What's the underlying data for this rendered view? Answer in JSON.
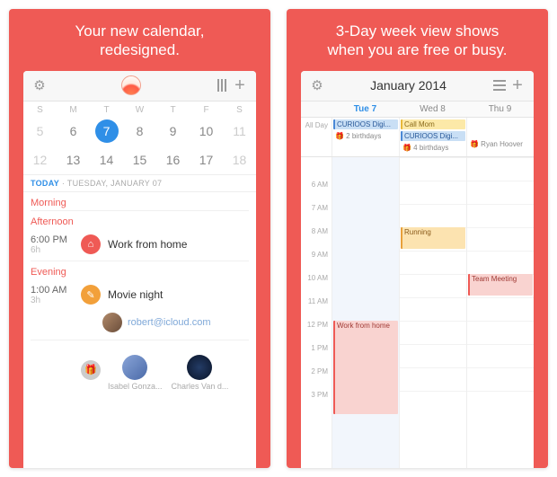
{
  "left": {
    "slogan_line1": "Your new calendar,",
    "slogan_line2": "redesigned.",
    "dow": [
      "S",
      "M",
      "T",
      "W",
      "T",
      "F",
      "S"
    ],
    "row1": [
      "5",
      "6",
      "7",
      "8",
      "9",
      "10",
      "11"
    ],
    "row2": [
      "12",
      "13",
      "14",
      "15",
      "16",
      "17",
      "18"
    ],
    "today_label": "TODAY",
    "today_sep": " · ",
    "today_date": "TUESDAY, JANUARY 07",
    "sections": {
      "morning": "Morning",
      "afternoon": "Afternoon",
      "evening": "Evening"
    },
    "events": {
      "work": {
        "time": "6:00 PM",
        "duration": "6h",
        "title": "Work from home"
      },
      "movie": {
        "time": "1:00 AM",
        "duration": "3h",
        "title": "Movie night"
      }
    },
    "attendee_email": "robert@icloud.com",
    "birthdays": {
      "gift_label": "",
      "p1": "Isabel Gonza...",
      "p2": "Charles Van d..."
    }
  },
  "right": {
    "slogan_line1": "3-Day week view shows",
    "slogan_line2": "when you are free or busy.",
    "title": "January 2014",
    "days": {
      "tue": "Tue 7",
      "wed": "Wed 8",
      "thu": "Thu 9"
    },
    "allday_label": "All Day",
    "allday": {
      "tue": [
        {
          "label": "CURIOOS Digi...",
          "cls": "blue"
        },
        {
          "label": "🎁 2 birthdays",
          "cls": "gray"
        }
      ],
      "wed": [
        {
          "label": "Call Mom",
          "cls": "yel"
        },
        {
          "label": "CURIOOS Digi...",
          "cls": "blue"
        },
        {
          "label": "🎁 4 birthdays",
          "cls": "gray"
        }
      ],
      "thu": [
        {
          "label": "",
          "cls": ""
        },
        {
          "label": "",
          "cls": ""
        },
        {
          "label": "🎁 Ryan Hoover",
          "cls": "gray"
        }
      ]
    },
    "hours": [
      "",
      "6 AM",
      "7 AM",
      "8 AM",
      "9 AM",
      "10 AM",
      "11 AM",
      "12 PM",
      "1 PM",
      "2 PM",
      "3 PM"
    ],
    "blocks": {
      "running": "Running",
      "team": "Team Meeting",
      "wfh": "Work from home"
    }
  }
}
